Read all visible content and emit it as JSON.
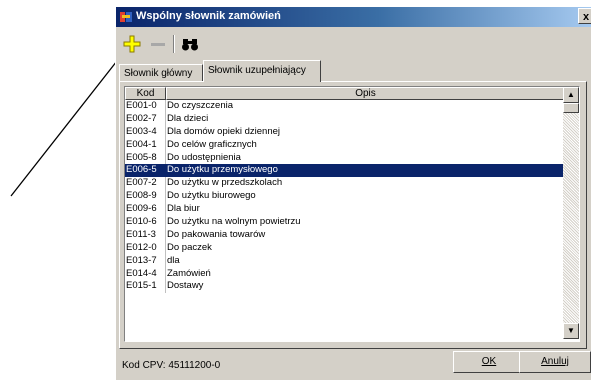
{
  "window": {
    "title": "Wspólny słownik zamówień",
    "close_glyph": "x"
  },
  "toolbar": {
    "add_icon": "plus-icon",
    "remove_icon": "minus-icon",
    "find_icon": "binoculars-icon",
    "add_color": "#ffff00"
  },
  "tabs": [
    {
      "label": "Słownik główny",
      "active": false
    },
    {
      "label": "Słownik uzupełniający",
      "active": true
    }
  ],
  "list": {
    "columns": {
      "kod": "Kod",
      "opis": "Opis"
    },
    "rows": [
      {
        "kod": "E001-0",
        "opis": "Do czyszczenia"
      },
      {
        "kod": "E002-7",
        "opis": "Dla dzieci"
      },
      {
        "kod": "E003-4",
        "opis": "Dla domów opieki dziennej"
      },
      {
        "kod": "E004-1",
        "opis": "Do celów graficznych"
      },
      {
        "kod": "E005-8",
        "opis": "Do udostępnienia"
      },
      {
        "kod": "E006-5",
        "opis": "Do użytku przemysłowego",
        "selected": true
      },
      {
        "kod": "E007-2",
        "opis": "Do użytku w przedszkolach"
      },
      {
        "kod": "E008-9",
        "opis": "Do użytku biurowego"
      },
      {
        "kod": "E009-6",
        "opis": "Dla biur"
      },
      {
        "kod": "E010-6",
        "opis": "Do użytku na wolnym powietrzu"
      },
      {
        "kod": "E011-3",
        "opis": "Do pakowania towarów"
      },
      {
        "kod": "E012-0",
        "opis": "Do paczek"
      },
      {
        "kod": "E013-7",
        "opis": "dla"
      },
      {
        "kod": "E014-4",
        "opis": "Zamówień"
      },
      {
        "kod": "E015-1",
        "opis": "Dostawy"
      }
    ],
    "scroll_up_glyph": "▲",
    "scroll_down_glyph": "▼",
    "selected_color": "#0a246a"
  },
  "footer": {
    "status": "Kod CPV: 45111200-0",
    "ok_label": "OK",
    "cancel_label": "Anuluj"
  }
}
